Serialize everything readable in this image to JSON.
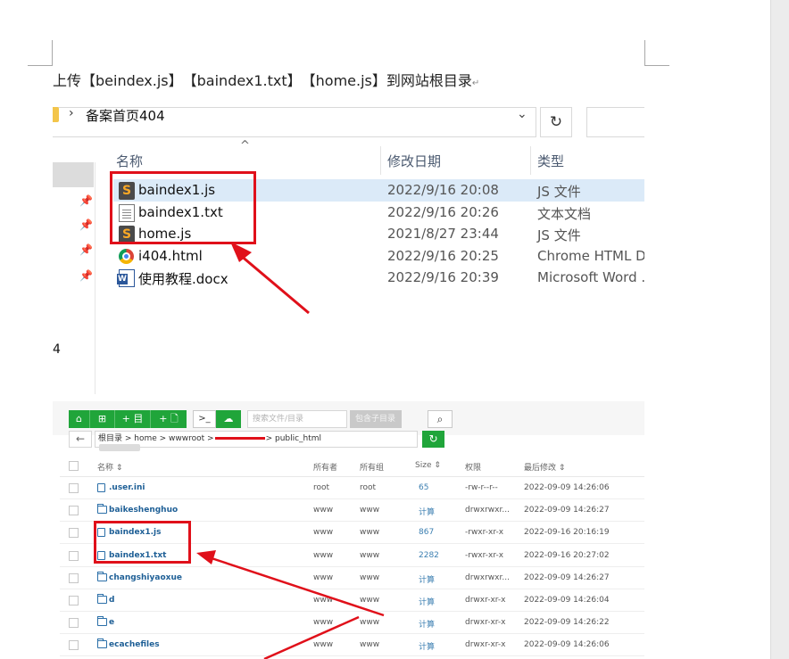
{
  "document": {
    "instruction": "上传【beindex.js】　【baindex1.txt】　【home.js】到网站根目录",
    "paragraph_mark": "↵"
  },
  "explorer": {
    "path_separator": "›",
    "path": "备案首页404",
    "dropdown_glyph": "⌄",
    "refresh_glyph": "↻",
    "sort_caret": "^",
    "nav_number": "4",
    "pin_glyph": "📌",
    "columns": {
      "name": "名称",
      "modified": "修改日期",
      "type": "类型"
    },
    "files": [
      {
        "name": "baindex1.js",
        "date": "2022/9/16 20:08",
        "type": "JS 文件",
        "icon": "sublime-file-icon",
        "icon_glyph": "S"
      },
      {
        "name": "baindex1.txt",
        "date": "2022/9/16 20:26",
        "type": "文本文档",
        "icon": "text-file-icon",
        "icon_glyph": ""
      },
      {
        "name": "home.js",
        "date": "2021/8/27 23:44",
        "type": "JS 文件",
        "icon": "sublime-file-icon",
        "icon_glyph": "S"
      },
      {
        "name": "i404.html",
        "date": "2022/9/16 20:25",
        "type": "Chrome HTML D...",
        "icon": "chrome-file-icon",
        "icon_glyph": ""
      },
      {
        "name": "使用教程.docx",
        "date": "2022/9/16 20:39",
        "type": "Microsoft Word ...",
        "icon": "word-file-icon",
        "icon_glyph": ""
      }
    ]
  },
  "filemanager": {
    "toolbar": {
      "home_glyph": "⌂",
      "grid_glyph": "⊞",
      "new_folder_label": "+ 目",
      "new_file_label": "+ 🗋",
      "terminal_glyph": ">_",
      "upload_glyph": "☁",
      "search_placeholder": "搜索文件/目录",
      "subdir_label": "包含子目录",
      "search_glyph": "⌕"
    },
    "back_glyph": "←",
    "breadcrumb_start": "根目录 > home > wwwroot >",
    "breadcrumb_end": "> public_html",
    "refresh_glyph": "↻",
    "columns": {
      "name": "名称 ⇕",
      "owner": "所有者",
      "group": "所有组",
      "size": "Size ⇕",
      "perms": "权限",
      "modified": "最后修改 ⇕"
    },
    "rows": [
      {
        "name": ".user.ini",
        "kind": "file",
        "owner": "root",
        "group": "root",
        "size": "65",
        "perms": "-rw-r--r--",
        "modified": "2022-09-09 14:26:06"
      },
      {
        "name": "baikeshenghuo",
        "kind": "folder",
        "owner": "www",
        "group": "www",
        "size": "计算",
        "perms": "drwxrwxr...",
        "modified": "2022-09-09 14:26:27"
      },
      {
        "name": "baindex1.js",
        "kind": "file",
        "owner": "www",
        "group": "www",
        "size": "867",
        "perms": "-rwxr-xr-x",
        "modified": "2022-09-16 20:16:19"
      },
      {
        "name": "baindex1.txt",
        "kind": "file",
        "owner": "www",
        "group": "www",
        "size": "2282",
        "perms": "-rwxr-xr-x",
        "modified": "2022-09-16 20:27:02"
      },
      {
        "name": "changshiyaoxue",
        "kind": "folder",
        "owner": "www",
        "group": "www",
        "size": "计算",
        "perms": "drwxrwxr...",
        "modified": "2022-09-09 14:26:27"
      },
      {
        "name": "d",
        "kind": "folder",
        "owner": "www",
        "group": "www",
        "size": "计算",
        "perms": "drwxr-xr-x",
        "modified": "2022-09-09 14:26:04"
      },
      {
        "name": "e",
        "kind": "folder",
        "owner": "www",
        "group": "www",
        "size": "计算",
        "perms": "drwxr-xr-x",
        "modified": "2022-09-09 14:26:22"
      },
      {
        "name": "ecachefiles",
        "kind": "folder",
        "owner": "www",
        "group": "www",
        "size": "计算",
        "perms": "drwxr-xr-x",
        "modified": "2022-09-09 14:26:06"
      }
    ]
  },
  "colors": {
    "annotation_red": "#e0101a",
    "bt_green": "#20a53a",
    "explorer_selection": "#dbeaf8"
  }
}
